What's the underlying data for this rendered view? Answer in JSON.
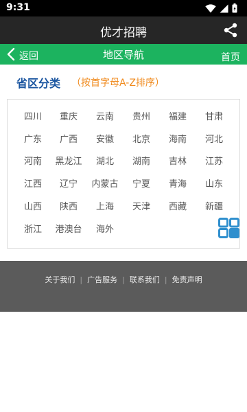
{
  "status_bar": {
    "time": "9:31",
    "icons": [
      "wifi-icon",
      "signal-icon",
      "battery-icon"
    ]
  },
  "app_bar": {
    "title": "优才招聘",
    "action_icon": "share-icon"
  },
  "nav_bar": {
    "back_label": "返回",
    "title": "地区导航",
    "home_label": "首页",
    "color": "#1cb35f"
  },
  "section": {
    "title": "省区分类",
    "note": "（按首字母A-Z排序）"
  },
  "regions": [
    "四川",
    "重庆",
    "云南",
    "贵州",
    "福建",
    "甘肃",
    "广东",
    "广西",
    "安徽",
    "北京",
    "海南",
    "河北",
    "河南",
    "黑龙江",
    "湖北",
    "湖南",
    "吉林",
    "江苏",
    "江西",
    "辽宁",
    "内蒙古",
    "宁夏",
    "青海",
    "山东",
    "山西",
    "陕西",
    "上海",
    "天津",
    "西藏",
    "新疆",
    "浙江",
    "港澳台",
    "海外"
  ],
  "floating_icon": "grid-icon",
  "footer": {
    "links": [
      "关于我们",
      "广告服务",
      "联系我们",
      "免责声明"
    ]
  }
}
